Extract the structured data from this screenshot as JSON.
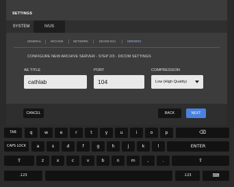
{
  "dialog": {
    "title": "SETTINGS",
    "main_tabs": [
      {
        "label": "SYSTEM",
        "active": false
      },
      {
        "label": "IVUS",
        "active": true
      }
    ],
    "sub_tabs": [
      {
        "label": "GENERAL",
        "active": false
      },
      {
        "label": "ARCHIVE",
        "active": false
      },
      {
        "label": "NETWORK",
        "active": false
      },
      {
        "label": "DICOM SCU",
        "active": false
      },
      {
        "label": "SERVERS",
        "active": true
      }
    ],
    "step_title": "CONFIGURE NEW ARCHIVE SERVER - STEP 2/3 - DICOM SETTINGS",
    "fields": {
      "ae_title": {
        "label": "AE TITLE",
        "value": "cathlab"
      },
      "port": {
        "label": "PORT",
        "value": "104"
      },
      "compression": {
        "label": "COMPRESSION",
        "value": "Low (High Quality)"
      }
    },
    "buttons": {
      "cancel": "CANCEL",
      "back": "BACK",
      "next": "NEXT"
    }
  },
  "keyboard": {
    "tab": "TAB",
    "row1": [
      "q",
      "w",
      "e",
      "r",
      "t",
      "y",
      "u",
      "i",
      "o",
      "p"
    ],
    "backspace": "⌫",
    "caps_lock": "CAPS LOCK",
    "row2": [
      "a",
      "s",
      "d",
      "f",
      "g",
      "h",
      "j",
      "k",
      "l"
    ],
    "enter": "ENTER",
    "shift_left": "⇧",
    "row3": [
      "z",
      "x",
      "c",
      "v",
      "b",
      "n",
      "m",
      ",",
      "."
    ],
    "shift_right": "⇧",
    "num_left": ".123",
    "space": "",
    "num_right": ".123",
    "hide": "⌨"
  },
  "colors": {
    "accent": "#4a82e0",
    "active_subtab": "#a7b8f0"
  }
}
